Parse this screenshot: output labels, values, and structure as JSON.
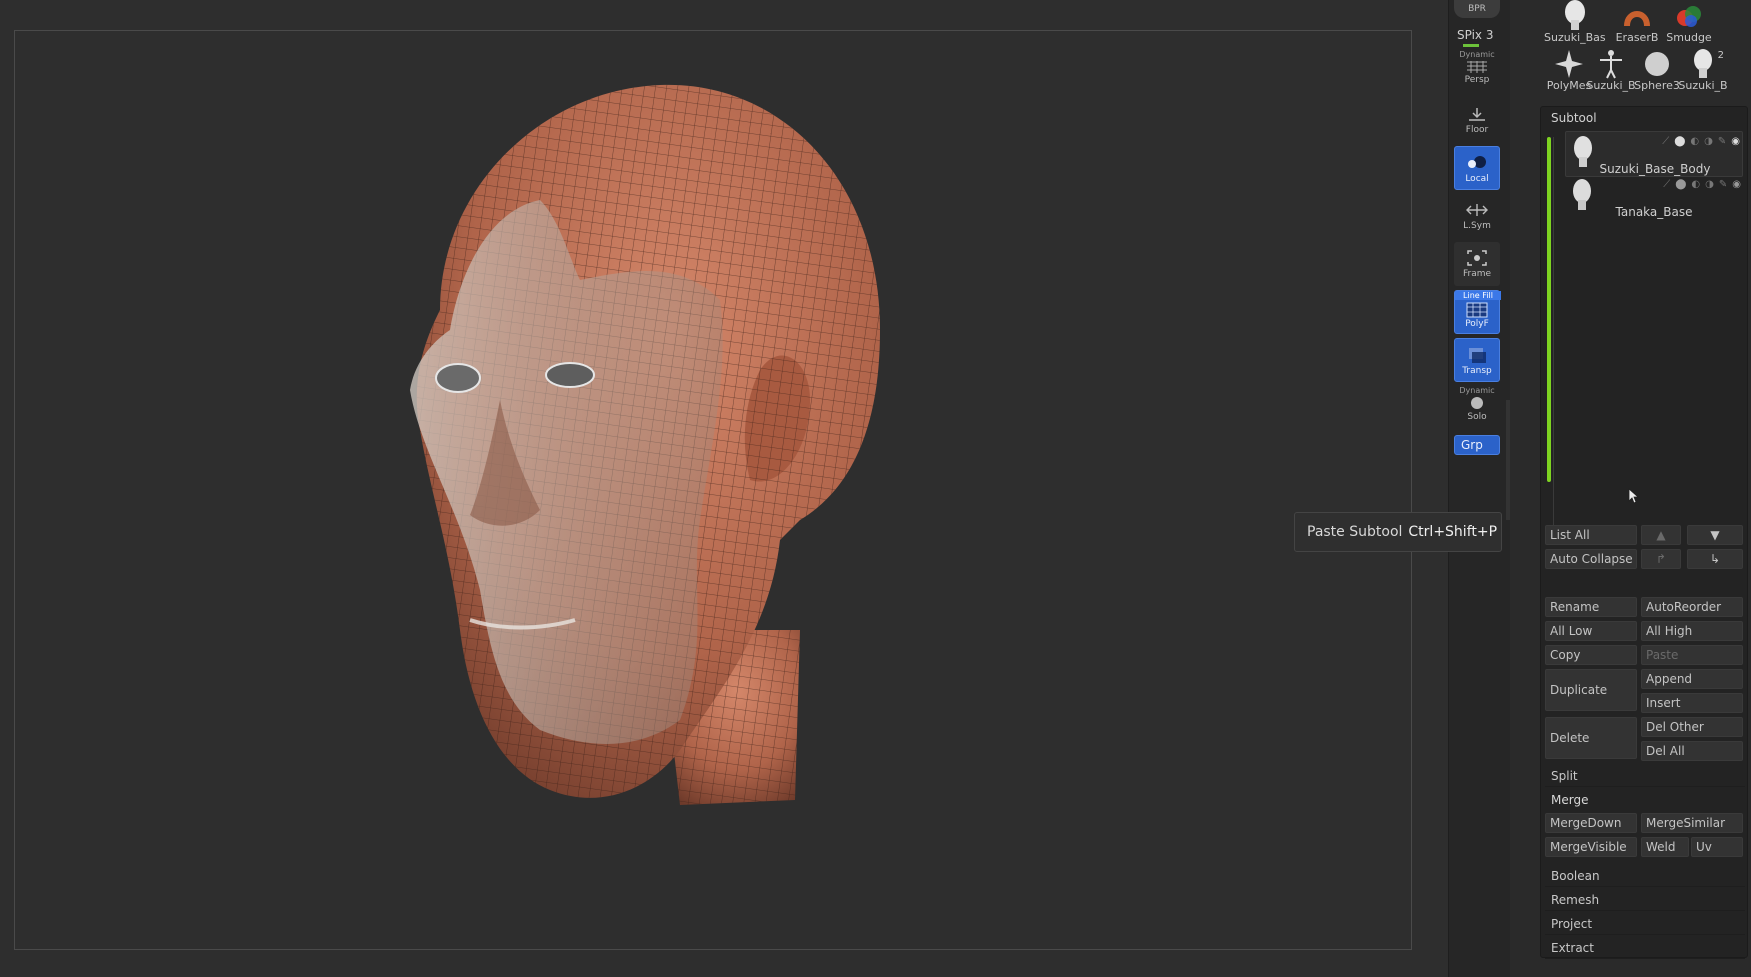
{
  "shelf": {
    "bpr": "BPR",
    "spix": "SPix 3",
    "persp_top": "Dynamic",
    "persp": "Persp",
    "floor": "Floor",
    "local": "Local",
    "lsym": "L.Sym",
    "frame": "Frame",
    "polyf_top": "Line Fill",
    "polyf": "PolyF",
    "transp": "Transp",
    "solo_top": "Dynamic",
    "solo": "Solo",
    "grp": "Grp"
  },
  "tool_thumbs": [
    {
      "label": "Suzuki_Base_Bo"
    },
    {
      "label": "EraserB"
    },
    {
      "label": "Smudge"
    },
    {
      "label": "PolyMes"
    },
    {
      "label": "Suzuki_B"
    },
    {
      "label": "Sphere3"
    },
    {
      "label": "Suzuki_B"
    }
  ],
  "thumb_badge": "2",
  "subtool": {
    "title": "Subtool",
    "items": [
      {
        "name": "Suzuki_Base_Body"
      },
      {
        "name": "Tanaka_Base"
      }
    ],
    "buttons": {
      "list_all": "List All",
      "auto_collapse": "Auto Collapse",
      "rename": "Rename",
      "autoreorder": "AutoReorder",
      "all_low": "All Low",
      "all_high": "All High",
      "copy": "Copy",
      "paste": "Paste",
      "duplicate": "Duplicate",
      "append": "Append",
      "insert": "Insert",
      "delete": "Delete",
      "del_other": "Del Other",
      "del_all": "Del All",
      "mergedown": "MergeDown",
      "mergesimilar": "MergeSimilar",
      "mergevisible": "MergeVisible",
      "weld": "Weld",
      "uv": "Uv"
    },
    "sections": {
      "split": "Split",
      "merge": "Merge",
      "boolean": "Boolean",
      "remesh": "Remesh",
      "project": "Project",
      "extract": "Extract"
    }
  },
  "tooltip": {
    "label": "Paste Subtool",
    "shortcut": "Ctrl+Shift+P"
  },
  "colors": {
    "accent_blue": "#2b62c9",
    "green_bar": "#7ed321",
    "skin": "#b86a4e"
  }
}
